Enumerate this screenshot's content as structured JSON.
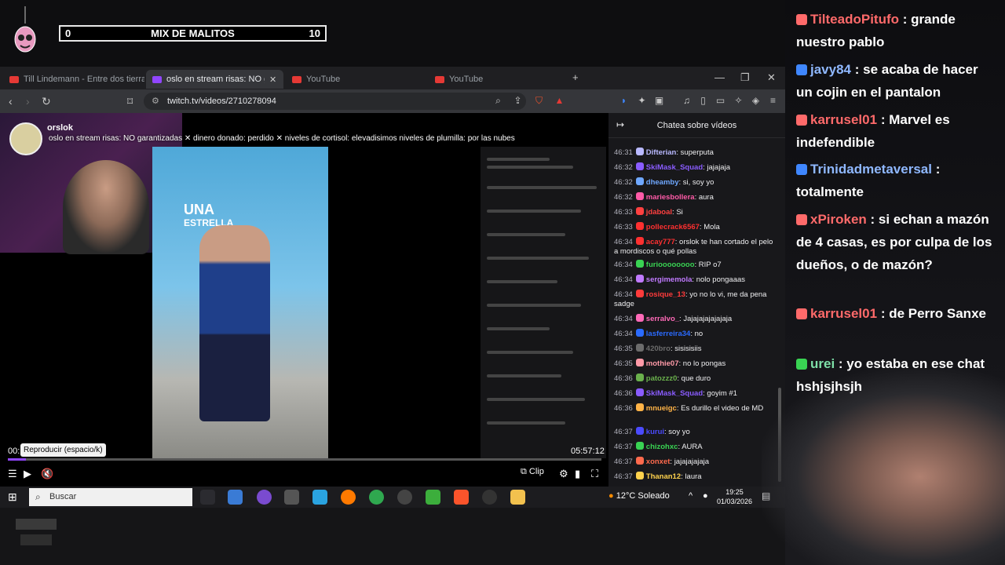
{
  "overlay": {
    "score_left": "0",
    "title": "MIX DE MALITOS",
    "score_right": "10"
  },
  "browser": {
    "tabs": [
      {
        "label": "Till Lindemann - Entre dos tierras (Of"
      },
      {
        "label": "oslo en stream risas: NO g"
      },
      {
        "label": "YouTube"
      },
      {
        "label": "YouTube"
      }
    ],
    "new_tab": "+",
    "url": "twitch.tv/videos/2710278094"
  },
  "video": {
    "channel_name": "orslok",
    "stream_title": "oslo en stream risas: NO garantizadas ✕ dinero donado: perdido ✕ niveles de cortisol: elevadisimos niveles de plumilla: por las nubes",
    "promo_big": "UNA",
    "promo_small": "ESTRELLA",
    "time_current": "00:",
    "time_total": "05:57:12",
    "tooltip": "Reproducir (espacio/k)",
    "progress": 0.03,
    "clip_label": "Clip"
  },
  "chat": {
    "header": "Chatea sobre vídeos",
    "messages": [
      {
        "time": "46:31",
        "user": "Difterian",
        "color": "#b9b9ff",
        "text": "superputa"
      },
      {
        "time": "46:32",
        "user": "SkiMask_Squad",
        "color": "#8a5cff",
        "text": "jajajaja"
      },
      {
        "time": "46:32",
        "user": "dheamby",
        "color": "#6fa8ff",
        "text": "si, soy yo"
      },
      {
        "time": "46:32",
        "user": "mariesbollera",
        "color": "#ff5ba8",
        "text": "aura"
      },
      {
        "time": "46:33",
        "user": "jdaboal",
        "color": "#ff4040",
        "text": "Si"
      },
      {
        "time": "46:33",
        "user": "pollecrack6567",
        "color": "#ff3030",
        "text": "Mola"
      },
      {
        "time": "46:34",
        "user": "acay777",
        "color": "#ff3030",
        "text": "orslok te han cortado el pelo a mordiscos o qué pollas"
      },
      {
        "time": "46:34",
        "user": "furioooooooo",
        "color": "#39d353",
        "text": "RIP o7"
      },
      {
        "time": "46:34",
        "user": "sergimemola",
        "color": "#c07aff",
        "text": "nolo pongaaas"
      },
      {
        "time": "46:34",
        "user": "rosique_13",
        "color": "#ff3b3b",
        "text": "yo no lo vi, me da pena sadge"
      },
      {
        "time": "46:34",
        "user": "serralvo_",
        "color": "#ff6ab8",
        "text": "Jajajajajajajaja"
      },
      {
        "time": "46:34",
        "user": "lasferreira34",
        "color": "#2b6bff",
        "text": "no"
      },
      {
        "time": "46:35",
        "user": "420bro",
        "color": "#6c6c6c",
        "text": "sisisisiis"
      },
      {
        "time": "46:35",
        "user": "mothie07",
        "color": "#ff9aa8",
        "text": "no lo pongas"
      },
      {
        "time": "46:36",
        "user": "patozzz0",
        "color": "#6ab04c",
        "text": "que duro"
      },
      {
        "time": "46:36",
        "user": "SkiMask_Squad",
        "color": "#8a5cff",
        "text": "goyim #1"
      },
      {
        "time": "46:36",
        "user": "mnueigc",
        "color": "#ffb347",
        "text": "Es durillo el video de MD"
      },
      {
        "time": "46:37",
        "user": "kurui",
        "color": "#4b4bff",
        "text": "soy yo"
      },
      {
        "time": "46:37",
        "user": "chizohxc",
        "color": "#39d353",
        "text": "AURA"
      },
      {
        "time": "46:37",
        "user": "xonxet",
        "color": "#ff6a4d",
        "text": "jajajajajaja"
      },
      {
        "time": "46:37",
        "user": "Thanan12",
        "color": "#ffd24d",
        "text": "laura"
      }
    ]
  },
  "taskbar": {
    "search_placeholder": "Buscar",
    "weather": "12°C Soleado",
    "time": "19:25",
    "date": "01/03/2026"
  },
  "big_chat": [
    {
      "user": "TilteadoPitufo",
      "color": "red",
      "text": ": grande nuestro pablo"
    },
    {
      "user": "javy84",
      "color": "blue",
      "text": ": se acaba de hacer un cojin en el pantalon"
    },
    {
      "user": "karrusel01",
      "color": "red",
      "text": ": Marvel es indefendible"
    },
    {
      "user": "Trinidadmetaversal",
      "color": "blue",
      "text": ": totalmente"
    },
    {
      "user": "xPiroken",
      "color": "red",
      "text": ": si echan a mazón de 4 casas, es por culpa de los dueños, o de mazón?"
    },
    {
      "user": "karrusel01",
      "color": "red",
      "text": ": de Perro Sanxe"
    },
    {
      "user": "urei",
      "color": "green",
      "text": ": yo estaba en ese chat hshjsjhsjh"
    }
  ]
}
